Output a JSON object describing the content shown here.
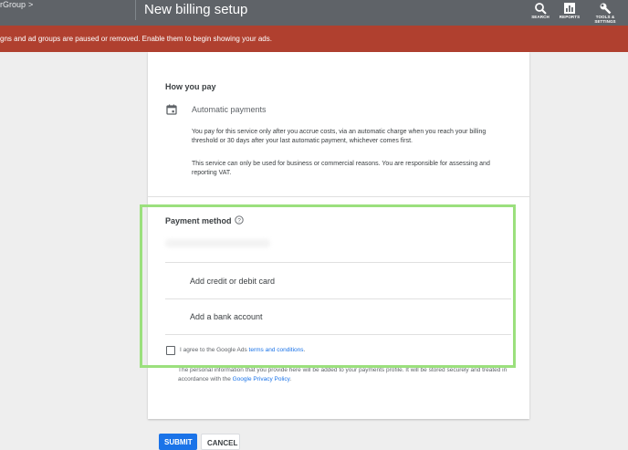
{
  "header": {
    "breadcrumb": "rGroup",
    "breadcrumb_sep": ">",
    "title": "New billing setup",
    "tools": [
      {
        "label": "SEARCH",
        "icon": "search-icon"
      },
      {
        "label": "REPORTS",
        "icon": "reports-icon"
      },
      {
        "label_line1": "TOOLS &",
        "label_line2": "SETTINGS",
        "icon": "wrench-icon"
      }
    ]
  },
  "alert": {
    "text": "gns and ad groups are paused or removed. Enable them to begin showing your ads.",
    "color": "#b0402f"
  },
  "how_you_pay": {
    "title": "How you pay",
    "method_label": "Automatic payments",
    "description": "You pay for this service only after you accrue costs, via an automatic charge when you reach your billing threshold or 30 days after your last automatic payment, whichever comes first.",
    "notice": "This service can only be used for business or commercial reasons. You are responsible for assessing and reporting VAT."
  },
  "payment_method": {
    "title": "Payment method",
    "options": [
      "Add credit or debit card",
      "Add a bank account"
    ]
  },
  "agreement": {
    "prefix": "I agree to the Google Ads ",
    "link": "terms and conditions",
    "suffix": "."
  },
  "privacy": {
    "text": "The personal information that you provide here will be added to your payments profile. It will be stored securely and treated in accordance with the ",
    "link": "Google Privacy Policy",
    "suffix": "."
  },
  "actions": {
    "submit": "SUBMIT",
    "cancel": "CANCEL"
  },
  "colors": {
    "topbar": "#5f6368",
    "primary": "#1a73e8",
    "highlight": "#9be07d"
  }
}
